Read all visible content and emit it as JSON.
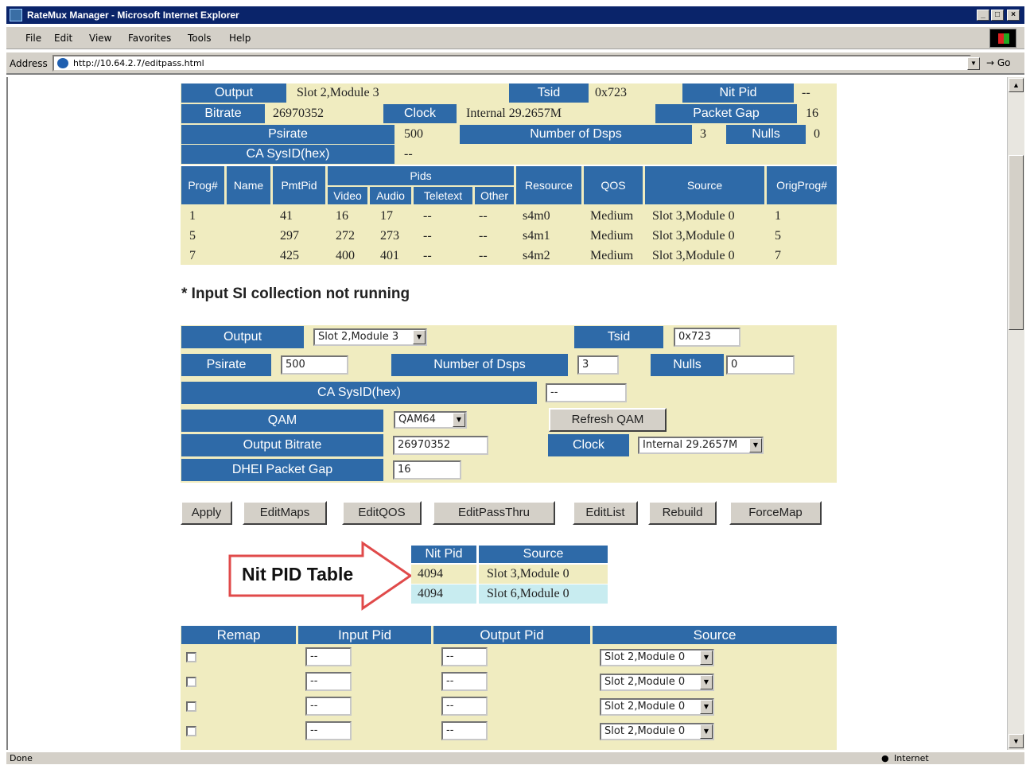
{
  "window": {
    "title": "RateMux Manager - Microsoft Internet Explorer",
    "controls": [
      "_",
      "□",
      "×"
    ]
  },
  "menu": [
    "File",
    "Edit",
    "View",
    "Favorites",
    "Tools",
    "Help"
  ],
  "address": {
    "label": "Address",
    "url": "http://10.64.2.7/editpass.html",
    "go": "Go"
  },
  "status": {
    "left": "Done",
    "zone": "Internet"
  },
  "summary": {
    "output_label": "Output",
    "output_value": "Slot 2,Module 3",
    "tsid_label": "Tsid",
    "tsid_value": "0x723",
    "nitpid_label": "Nit Pid",
    "nitpid_value": "--",
    "bitrate_label": "Bitrate",
    "bitrate_value": "26970352",
    "clock_label": "Clock",
    "clock_value": "Internal 29.2657M",
    "packetgap_label": "Packet Gap",
    "packetgap_value": "16",
    "psirate_label": "Psirate",
    "psirate_value": "500",
    "numdsps_label": "Number of Dsps",
    "numdsps_value": "3",
    "nulls_label": "Nulls",
    "nulls_value": "0",
    "casysid_label": "CA SysID(hex)",
    "casysid_value": "--"
  },
  "prog_table": {
    "headers": {
      "prog": "Prog#",
      "name": "Name",
      "pmtpid": "PmtPid",
      "pids": "Pids",
      "video": "Video",
      "audio": "Audio",
      "teletext": "Teletext",
      "other": "Other",
      "resource": "Resource",
      "qos": "QOS",
      "source": "Source",
      "origprog": "OrigProg#"
    },
    "rows": [
      [
        "1",
        "",
        "41",
        "16",
        "17",
        "--",
        "--",
        "s4m0",
        "Medium",
        "Slot 3,Module 0",
        "1"
      ],
      [
        "5",
        "",
        "297",
        "272",
        "273",
        "--",
        "--",
        "s4m1",
        "Medium",
        "Slot 3,Module 0",
        "5"
      ],
      [
        "7",
        "",
        "425",
        "400",
        "401",
        "--",
        "--",
        "s4m2",
        "Medium",
        "Slot 3,Module 0",
        "7"
      ]
    ]
  },
  "note": "* Input SI collection not running",
  "form": {
    "output_label": "Output",
    "output_select": "Slot 2,Module 3",
    "tsid_label": "Tsid",
    "tsid_input": "0x723",
    "psirate_label": "Psirate",
    "psirate_input": "500",
    "numdsps_label": "Number of Dsps",
    "numdsps_input": "3",
    "nulls_label": "Nulls",
    "nulls_input": "0",
    "casysid_label": "CA SysID(hex)",
    "casysid_input": "--",
    "qam_label": "QAM",
    "qam_select": "QAM64",
    "refresh_qam": "Refresh QAM",
    "bitrate_label": "Output Bitrate",
    "bitrate_input": "26970352",
    "clock_label": "Clock",
    "clock_select": "Internal 29.2657M",
    "dhei_label": "DHEI Packet Gap",
    "dhei_input": "16"
  },
  "buttons": [
    "Apply",
    "EditMaps",
    "EditQOS",
    "EditPassThru",
    "EditList",
    "Rebuild",
    "ForceMap"
  ],
  "callout": "Nit PID Table",
  "nit_table": {
    "headers": [
      "Nit Pid",
      "Source"
    ],
    "rows": [
      [
        "4094",
        "Slot 3,Module 0"
      ],
      [
        "4094",
        "Slot 6,Module 0"
      ]
    ]
  },
  "remap_table": {
    "headers": [
      "Remap",
      "Input Pid",
      "Output Pid",
      "Source"
    ],
    "rows": [
      {
        "input": "--",
        "output": "--",
        "source": "Slot 2,Module 0"
      },
      {
        "input": "--",
        "output": "--",
        "source": "Slot 2,Module 0"
      },
      {
        "input": "--",
        "output": "--",
        "source": "Slot 2,Module 0"
      },
      {
        "input": "--",
        "output": "--",
        "source": "Slot 2,Module 0"
      }
    ]
  }
}
